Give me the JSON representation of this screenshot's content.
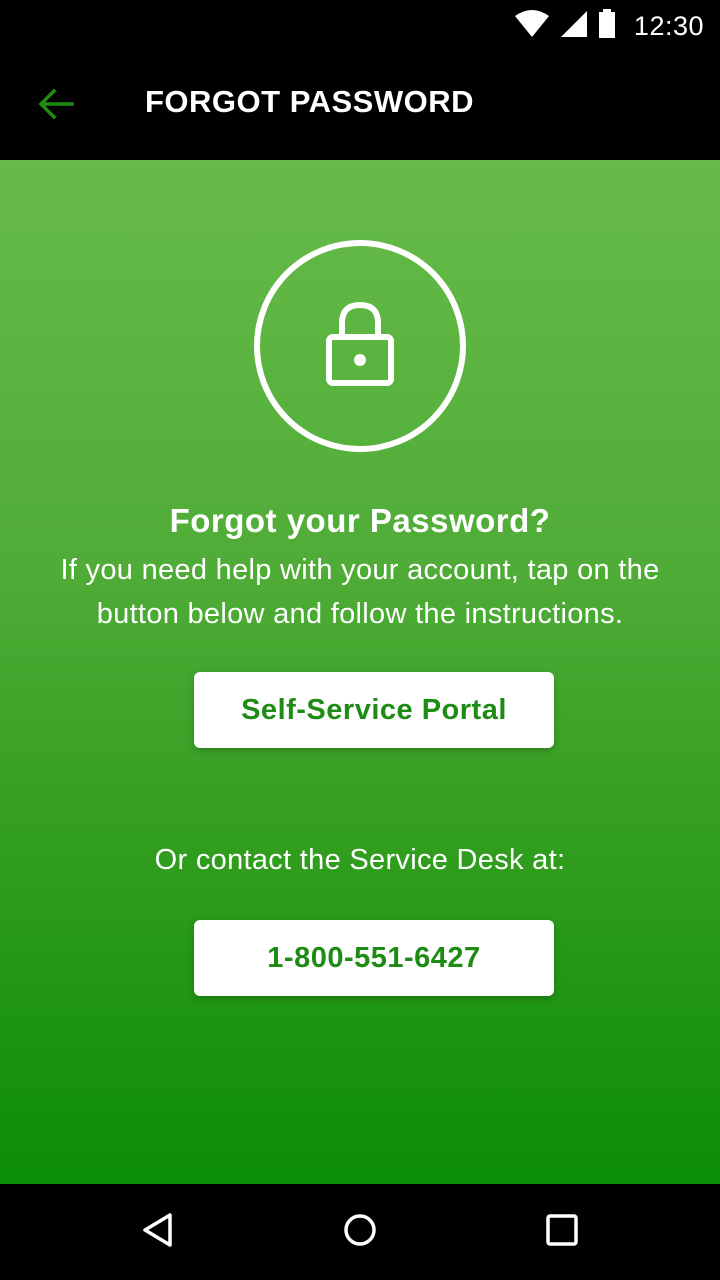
{
  "status_bar": {
    "time": "12:30",
    "icons": [
      "wifi-icon",
      "signal-icon",
      "battery-icon"
    ]
  },
  "app_bar": {
    "title": "FORGOT PASSWORD",
    "back_icon": "arrow-left-icon"
  },
  "main": {
    "icon": "lock-icon",
    "heading": "Forgot your Password?",
    "description": "If you need help with your account, tap on the button below and follow the instructions.",
    "portal_button_label": "Self-Service Portal",
    "contact_text": "Or contact the Service Desk at:",
    "phone_button_label": "1-800-551-6427"
  },
  "nav_bar": {
    "icons": [
      "back-triangle-icon",
      "home-circle-icon",
      "recents-square-icon"
    ]
  },
  "colors": {
    "accent_green": "#1e8c14",
    "back_arrow_green": "#1e8c14",
    "gradient_top": "#67bb49",
    "gradient_bottom": "#0b8d06",
    "bar_background": "#000000"
  }
}
